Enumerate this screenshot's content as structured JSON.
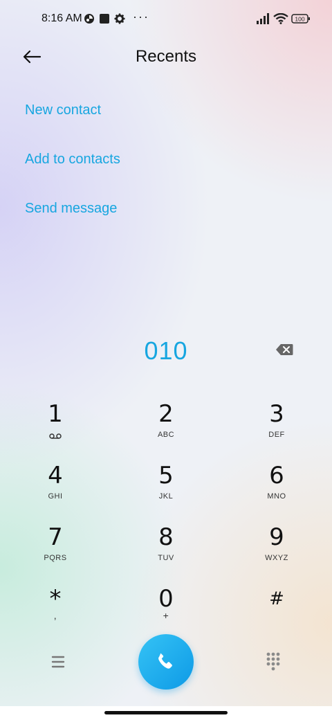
{
  "status_bar": {
    "time": "8:16 AM",
    "icons": [
      "data-saver-icon",
      "square-notification-icon",
      "gear-icon",
      "more-dots-icon",
      "signal-icon",
      "wifi-icon",
      "battery-icon"
    ],
    "more": "···",
    "battery": "100"
  },
  "header": {
    "title": "Recents",
    "back_icon": "back-arrow-icon"
  },
  "actions": [
    {
      "label": "New contact"
    },
    {
      "label": "Add to contacts"
    },
    {
      "label": "Send message"
    }
  ],
  "dial": {
    "number": "010",
    "backspace_icon": "backspace-icon"
  },
  "keypad": [
    {
      "digit": "1",
      "letters": "",
      "sub_icon": "voicemail-icon"
    },
    {
      "digit": "2",
      "letters": "ABC"
    },
    {
      "digit": "3",
      "letters": "DEF"
    },
    {
      "digit": "4",
      "letters": "GHI"
    },
    {
      "digit": "5",
      "letters": "JKL"
    },
    {
      "digit": "6",
      "letters": "MNO"
    },
    {
      "digit": "7",
      "letters": "PQRS"
    },
    {
      "digit": "8",
      "letters": "TUV"
    },
    {
      "digit": "9",
      "letters": "WXYZ"
    },
    {
      "digit": "*",
      "letters": ","
    },
    {
      "digit": "0",
      "letters": "+"
    },
    {
      "digit": "#",
      "letters": ""
    }
  ],
  "bottom_bar": {
    "menu_icon": "menu-icon",
    "call_icon": "phone-icon",
    "keypad_icon": "dialpad-icon"
  },
  "colors": {
    "accent": "#17a6e0",
    "call_button": "#1aa7ee"
  }
}
